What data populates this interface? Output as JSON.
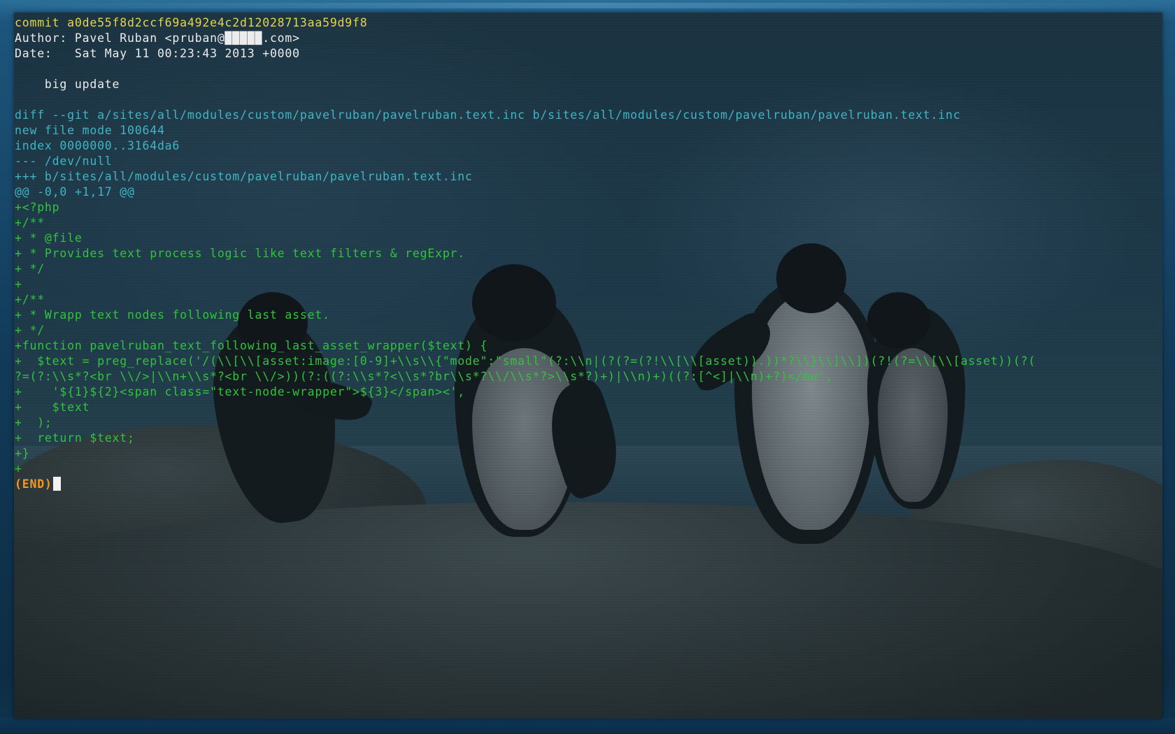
{
  "terminal": {
    "lines": [
      {
        "text": "commit a0de55f8d2ccf69a492e4c2d12028713aa59d9f8",
        "color": "yellow"
      },
      {
        "text": "Author: Pavel Ruban <pruban@█████.com>",
        "color": "white"
      },
      {
        "text": "Date:   Sat May 11 00:23:43 2013 +0000",
        "color": "white"
      },
      {
        "text": "",
        "color": "white"
      },
      {
        "text": "    big update",
        "color": "white"
      },
      {
        "text": "",
        "color": "white"
      },
      {
        "text": "diff --git a/sites/all/modules/custom/pavelruban/pavelruban.text.inc b/sites/all/modules/custom/pavelruban/pavelruban.text.inc",
        "color": "cyan"
      },
      {
        "text": "new file mode 100644",
        "color": "cyan"
      },
      {
        "text": "index 0000000..3164da6",
        "color": "cyan"
      },
      {
        "text": "--- /dev/null",
        "color": "cyan"
      },
      {
        "text": "+++ b/sites/all/modules/custom/pavelruban/pavelruban.text.inc",
        "color": "cyan"
      },
      {
        "text": "@@ -0,0 +1,17 @@",
        "color": "cyan"
      },
      {
        "text": "+<?php",
        "color": "green"
      },
      {
        "text": "+/**",
        "color": "green"
      },
      {
        "text": "+ * @file",
        "color": "green"
      },
      {
        "text": "+ * Provides text process logic like text filters & regExpr.",
        "color": "green"
      },
      {
        "text": "+ */",
        "color": "green"
      },
      {
        "text": "+",
        "color": "green"
      },
      {
        "text": "+/**",
        "color": "green"
      },
      {
        "text": "+ * Wrapp text nodes following last asset.",
        "color": "green"
      },
      {
        "text": "+ */",
        "color": "green"
      },
      {
        "text": "+function pavelruban_text_following_last_asset_wrapper($text) {",
        "color": "green"
      },
      {
        "text": "+  $text = preg_replace('/(\\\\[\\\\[asset:image:[0-9]+\\\\s\\\\{\"mode\":\"small\"(?:\\\\n|(?(?=(?!\\\\[\\\\[asset)).))*?\\\\}\\\\]\\\\])(?!(?=\\\\[\\\\[asset))(?(",
        "color": "green"
      },
      {
        "text": "?=(?:\\\\s*?<br \\\\/>|\\\\n+\\\\s*?<br \\\\/>))(?:((?:\\\\s*?<\\\\s*?br\\\\s*?\\\\/\\\\s*?>\\\\s*?)+)|\\\\n)+)((?:[^<]|\\\\n)+?)</mu',",
        "color": "green"
      },
      {
        "text": "+    '${1}${2}<span class=\"text-node-wrapper\">${3}</span><',",
        "color": "green"
      },
      {
        "text": "+    $text",
        "color": "green"
      },
      {
        "text": "+  );",
        "color": "green"
      },
      {
        "text": "+  return $text;",
        "color": "green"
      },
      {
        "text": "+}",
        "color": "green"
      },
      {
        "text": "+",
        "color": "green"
      }
    ],
    "end_marker": "(END)"
  },
  "colors": {
    "yellow": "#e6d44a",
    "white": "#ececec",
    "cyan": "#3fb6c4",
    "green": "#31c43b",
    "orange": "#f29b21"
  }
}
